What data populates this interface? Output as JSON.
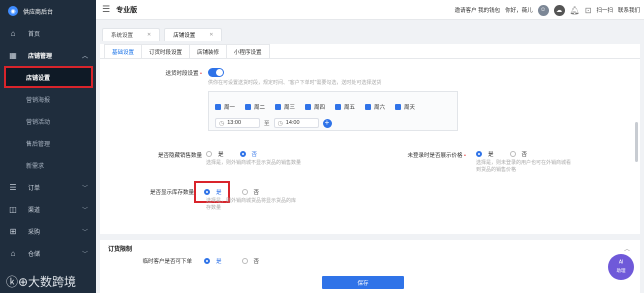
{
  "sidebar": {
    "logo_text": "供应商后台",
    "items": [
      {
        "label": "首页",
        "icon": "home-icon",
        "glyph": "⌂"
      },
      {
        "label": "店铺管理",
        "icon": "store-icon",
        "glyph": "▦",
        "expanded": true
      },
      {
        "label": "订单",
        "icon": "order-icon",
        "glyph": "☰"
      },
      {
        "label": "渠道",
        "icon": "channel-icon",
        "glyph": "◫"
      },
      {
        "label": "采购",
        "icon": "purchase-icon",
        "glyph": "⊞"
      },
      {
        "label": "仓储",
        "icon": "warehouse-icon",
        "glyph": "⌂"
      }
    ],
    "sub_items": [
      {
        "label": "店铺设置",
        "active": true
      },
      {
        "label": "营销海报"
      },
      {
        "label": "营销活动"
      },
      {
        "label": "售后管理"
      },
      {
        "label": "新需求"
      }
    ],
    "watermark": "ⓚ⊕大数跨境"
  },
  "topbar": {
    "brand": "专业版",
    "invite": "邀请客户 我的钱包",
    "greeting": "你好，薇儿",
    "scan": "扫一扫",
    "contact": "联系我们"
  },
  "tabs": [
    {
      "label": "系统设置",
      "active": false
    },
    {
      "label": "店铺设置",
      "active": true
    }
  ],
  "subtabs": [
    "基础设置",
    "订货时段设置",
    "店铺装修",
    "小程序设置"
  ],
  "form": {
    "delivery_time_label": "送货时段设置",
    "delivery_time_hint": "供你在可设置送货时段，规定时间、“客户下单时”需要勾选，送时处可选择送货",
    "weekdays": [
      "周一",
      "周二",
      "周三",
      "周四",
      "周五",
      "周六",
      "周天"
    ],
    "start_time": "13:00",
    "to": "至",
    "end_time": "14:00",
    "hide_sales_label": "是否隐藏销售数量",
    "hide_sales_options": [
      "是",
      "否"
    ],
    "hide_sales_selected": 1,
    "hide_sales_hint_1": "选择是，则外销商城不显示货品的销售数量",
    "show_price_label": "未登录时是否展示价格",
    "show_price_options": [
      "是",
      "否"
    ],
    "show_price_selected": 0,
    "show_price_hint_1": "选择是，则未登录的用户也可在外销商城看",
    "show_price_hint_2": "到货品的销售价格",
    "show_stock_label": "是否显示库存数量",
    "show_stock_options": [
      "是",
      "否"
    ],
    "show_stock_selected": 0,
    "show_stock_hint_1": "选择是，则外销商城货品将显示货品的库",
    "show_stock_hint_2": "存数量"
  },
  "section2": {
    "title": "订货限制",
    "temp_customer_label": "临时客户是否可下单",
    "options": [
      "是",
      "否"
    ]
  },
  "save_label": "保存",
  "help_label": "助理",
  "accent": "#2f73e8"
}
